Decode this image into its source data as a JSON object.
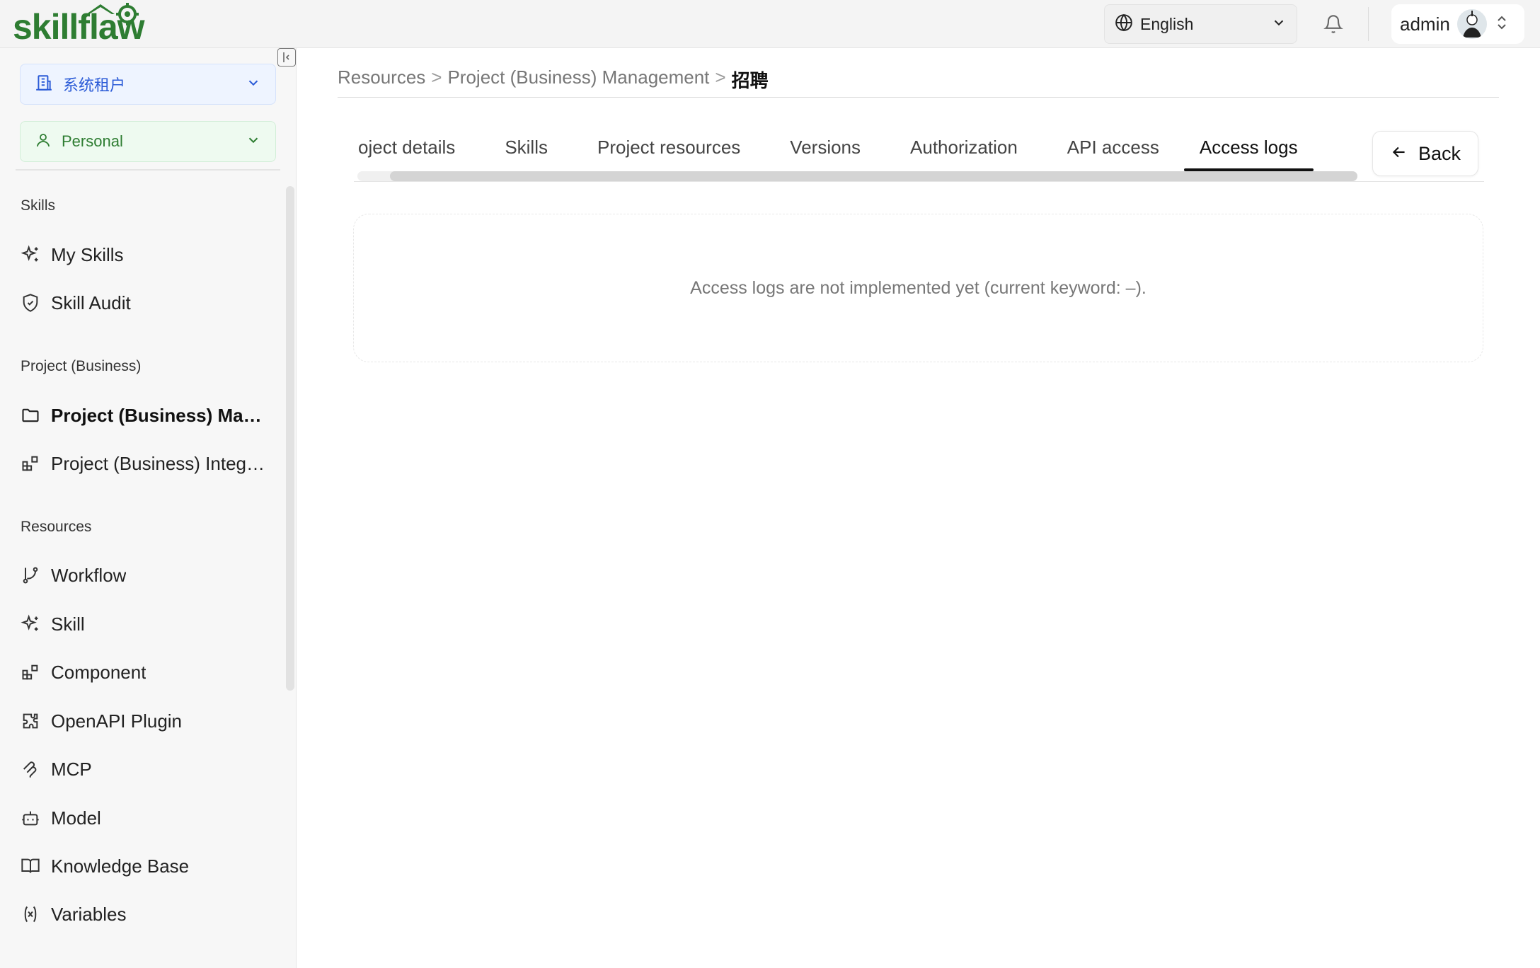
{
  "header": {
    "logo_text": "skillflaw",
    "language": {
      "selected": "English"
    },
    "user": {
      "name": "admin"
    }
  },
  "sidebar": {
    "tenant": {
      "label": "系统租户"
    },
    "space": {
      "label": "Personal"
    },
    "sections": [
      {
        "title": "Skills",
        "items": [
          {
            "label": "My Skills",
            "icon": "sparkle-icon"
          },
          {
            "label": "Skill Audit",
            "icon": "shield-check-icon"
          }
        ]
      },
      {
        "title": "Project (Business)",
        "items": [
          {
            "label": "Project (Business) Management",
            "icon": "folder-icon",
            "active": true
          },
          {
            "label": "Project (Business) Integration",
            "icon": "blocks-icon"
          }
        ]
      },
      {
        "title": "Resources",
        "items": [
          {
            "label": "Workflow",
            "icon": "git-branch-icon"
          },
          {
            "label": "Skill",
            "icon": "sparkle-icon"
          },
          {
            "label": "Component",
            "icon": "blocks-icon"
          },
          {
            "label": "OpenAPI Plugin",
            "icon": "puzzle-icon"
          },
          {
            "label": "MCP",
            "icon": "mcp-icon"
          },
          {
            "label": "Model",
            "icon": "bot-icon"
          },
          {
            "label": "Knowledge Base",
            "icon": "book-icon"
          },
          {
            "label": "Variables",
            "icon": "variable-icon"
          }
        ]
      }
    ]
  },
  "breadcrumb": {
    "items": [
      "Resources",
      "Project (Business) Management"
    ],
    "current": "招聘",
    "separator": ">"
  },
  "tabs": [
    {
      "label": "oject details"
    },
    {
      "label": "Skills"
    },
    {
      "label": "Project resources"
    },
    {
      "label": "Versions"
    },
    {
      "label": "Authorization"
    },
    {
      "label": "API access"
    },
    {
      "label": "Access logs",
      "active": true
    }
  ],
  "back_button": {
    "label": "Back"
  },
  "empty_state": {
    "message": "Access logs are not implemented yet (current keyword: –)."
  },
  "colors": {
    "brand_green": "#2e7d32",
    "tenant_blue": "#2b5bd7"
  }
}
